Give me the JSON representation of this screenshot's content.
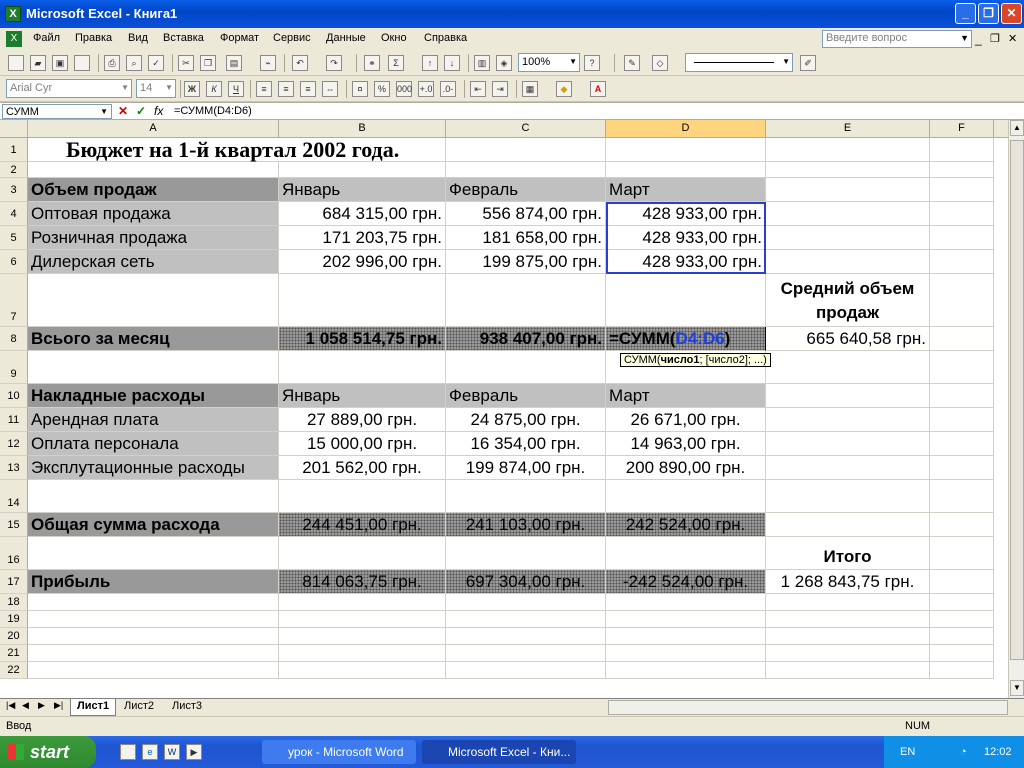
{
  "window": {
    "title": "Microsoft Excel - Книга1"
  },
  "menu": [
    "Файл",
    "Правка",
    "Вид",
    "Вставка",
    "Формат",
    "Сервис",
    "Данные",
    "Окно",
    "Справка"
  ],
  "ask_placeholder": "Введите вопрос",
  "toolbar": {
    "zoom": "100%",
    "font": "Arial Cyr",
    "size": "14"
  },
  "formula_bar": {
    "name_box": "СУММ",
    "formula": "=СУММ(D4:D6)"
  },
  "columns": [
    "A",
    "B",
    "C",
    "D",
    "E",
    "F"
  ],
  "selected_column": "D",
  "rows": [
    {
      "n": "1",
      "cells": {
        "A": "Бюджет на 1-й квартал 2002 года."
      }
    },
    {
      "n": "2",
      "cells": {}
    },
    {
      "n": "3",
      "cells": {
        "A": "Объем продаж",
        "B": "Январь",
        "C": "Февраль",
        "D": "Март"
      }
    },
    {
      "n": "4",
      "cells": {
        "A": "Оптовая продажа",
        "B": "684 315,00 грн.",
        "C": "556 874,00 грн.",
        "D": "428 933,00 грн."
      }
    },
    {
      "n": "5",
      "cells": {
        "A": "Розничная продажа",
        "B": "171 203,75 грн.",
        "C": "181 658,00 грн.",
        "D": "428 933,00 грн."
      }
    },
    {
      "n": "6",
      "cells": {
        "A": "Дилерская сеть",
        "B": "202 996,00 грн.",
        "C": "199 875,00 грн.",
        "D": "428 933,00 грн."
      }
    },
    {
      "n": "7",
      "cells": {
        "E": "Средний объем продаж"
      }
    },
    {
      "n": "8",
      "cells": {
        "A": "Всього за месяц",
        "B": "1 058 514,75 грн.",
        "C": "938 407,00 грн.",
        "D": "=СУММ(D4:D6)",
        "E": "665 640,58 грн."
      }
    },
    {
      "n": "9",
      "cells": {}
    },
    {
      "n": "10",
      "cells": {
        "A": "Накладные расходы",
        "B": "Январь",
        "C": "Февраль",
        "D": "Март"
      }
    },
    {
      "n": "11",
      "cells": {
        "A": "Арендная плата",
        "B": "27 889,00 грн.",
        "C": "24 875,00 грн.",
        "D": "26 671,00 грн."
      }
    },
    {
      "n": "12",
      "cells": {
        "A": "Оплата персонала",
        "B": "15 000,00 грн.",
        "C": "16 354,00 грн.",
        "D": "14 963,00 грн."
      }
    },
    {
      "n": "13",
      "cells": {
        "A": "Эксплутационные расходы",
        "B": "201 562,00 грн.",
        "C": "199 874,00 грн.",
        "D": "200 890,00 грн."
      }
    },
    {
      "n": "14",
      "cells": {}
    },
    {
      "n": "15",
      "cells": {
        "A": "Общая сумма расхода",
        "B": "244 451,00 грн.",
        "C": "241 103,00 грн.",
        "D": "242 524,00 грн."
      }
    },
    {
      "n": "16",
      "cells": {
        "E": "Итого"
      }
    },
    {
      "n": "17",
      "cells": {
        "A": "Прибыль",
        "B": "814 063,75 грн.",
        "C": "697 304,00 грн.",
        "D": "-242 524,00 грн.",
        "E": "1 268 843,75 грн."
      }
    },
    {
      "n": "18",
      "cells": {}
    },
    {
      "n": "19",
      "cells": {}
    },
    {
      "n": "20",
      "cells": {}
    },
    {
      "n": "21",
      "cells": {}
    },
    {
      "n": "22",
      "cells": {}
    }
  ],
  "tooltip": {
    "pre": "СУММ(",
    "bold": "число1",
    "post": "; [число2]; ...)"
  },
  "sheet_tabs": [
    "Лист1",
    "Лист2",
    "Лист3"
  ],
  "status": {
    "mode": "Ввод",
    "num": "NUM"
  },
  "taskbar": {
    "start": "start",
    "tasks": [
      "урок - Microsoft Word",
      "Microsoft Excel - Кни..."
    ],
    "lang": "EN",
    "clock": "12:02"
  }
}
